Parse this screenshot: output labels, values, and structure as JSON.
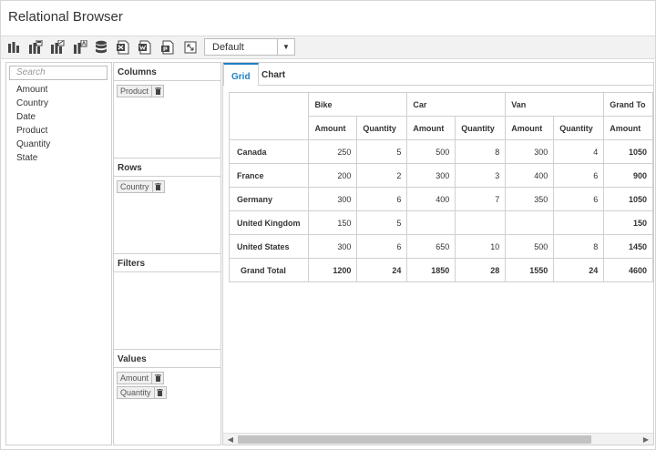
{
  "app": {
    "title": "Relational Browser"
  },
  "toolbar": {
    "buttons": [
      "new-report-icon",
      "save-report-icon",
      "save-as-icon",
      "rename-report-icon",
      "mdx-query-icon",
      "export-excel-icon",
      "export-word-icon",
      "export-pdf-icon",
      "fullscreen-icon"
    ],
    "report_selected": "Default"
  },
  "field_list": {
    "search_placeholder": "Search",
    "fields": [
      "Amount",
      "Country",
      "Date",
      "Product",
      "Quantity",
      "State"
    ]
  },
  "axes": {
    "columns": {
      "label": "Columns",
      "items": [
        "Product"
      ]
    },
    "rows": {
      "label": "Rows",
      "items": [
        "Country"
      ]
    },
    "filters": {
      "label": "Filters",
      "items": []
    },
    "values": {
      "label": "Values",
      "items": [
        "Amount",
        "Quantity"
      ]
    }
  },
  "tabs": {
    "grid": "Grid",
    "chart": "Chart"
  },
  "grid": {
    "products": [
      "Bike",
      "Car",
      "Van",
      "Grand To"
    ],
    "measures": [
      "Amount",
      "Quantity",
      "Amount",
      "Quantity",
      "Amount",
      "Quantity",
      "Amount"
    ],
    "rows": [
      {
        "label": "Canada",
        "cells": [
          "250",
          "5",
          "500",
          "8",
          "300",
          "4",
          "1050"
        ]
      },
      {
        "label": "France",
        "cells": [
          "200",
          "2",
          "300",
          "3",
          "400",
          "6",
          "900"
        ]
      },
      {
        "label": "Germany",
        "cells": [
          "300",
          "6",
          "400",
          "7",
          "350",
          "6",
          "1050"
        ]
      },
      {
        "label": "United Kingdom",
        "cells": [
          "150",
          "5",
          "",
          "",
          "",
          "",
          "150"
        ]
      },
      {
        "label": "United States",
        "cells": [
          "300",
          "6",
          "650",
          "10",
          "500",
          "8",
          "1450"
        ]
      }
    ],
    "total": {
      "label": "Grand Total",
      "cells": [
        "1200",
        "24",
        "1850",
        "28",
        "1550",
        "24",
        "4600"
      ]
    }
  },
  "colors": {
    "accent": "#1e7fc2",
    "border": "#d0d0d0",
    "toolbar_bg": "#f2f2f2"
  }
}
